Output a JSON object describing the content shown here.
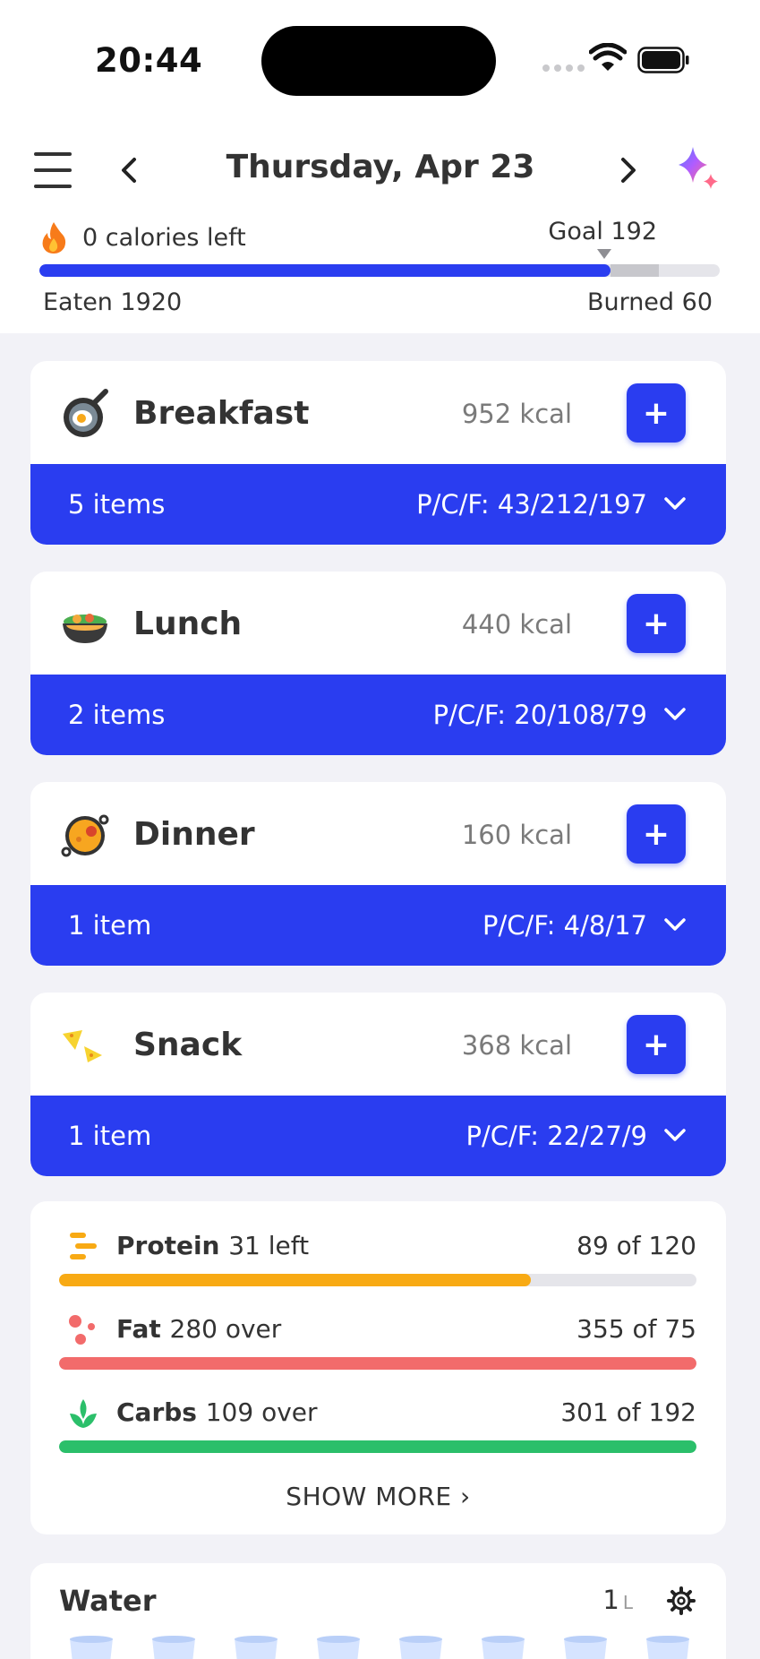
{
  "status_bar": {
    "time": "20:44"
  },
  "header": {
    "date": "Thursday, Apr 23"
  },
  "calories": {
    "left_label": "0 calories left",
    "goal_label": "Goal 192",
    "eaten_label": "Eaten 1920",
    "burned_label": "Burned 60",
    "progress_fraction": 0.84,
    "burned_fraction": 0.07
  },
  "meals": [
    {
      "name": "Breakfast",
      "kcal": "952 kcal",
      "items": "5 items",
      "pcf": "P/C/F: 43/212/197",
      "icon": "frying-pan-icon"
    },
    {
      "name": "Lunch",
      "kcal": "440 kcal",
      "items": "2 items",
      "pcf": "P/C/F: 20/108/79",
      "icon": "salad-bowl-icon"
    },
    {
      "name": "Dinner",
      "kcal": "160 kcal",
      "items": "1 item",
      "pcf": "P/C/F: 4/8/17",
      "icon": "paella-pan-icon"
    },
    {
      "name": "Snack",
      "kcal": "368 kcal",
      "items": "1 item",
      "pcf": "P/C/F: 22/27/9",
      "icon": "nachos-icon"
    }
  ],
  "add_label": "+",
  "macros": {
    "protein": {
      "name": "Protein",
      "status": "31 left",
      "value": "89 of 120",
      "fraction": 0.74,
      "color": "#f8aa14"
    },
    "fat": {
      "name": "Fat",
      "status": "280 over",
      "value": "355 of 75",
      "fraction": 1.0,
      "color": "#f26b6b"
    },
    "carbs": {
      "name": "Carbs",
      "status": "109 over",
      "value": "301 of 192",
      "fraction": 1.0,
      "color": "#2bbf6a"
    },
    "show_more": "SHOW MORE ›"
  },
  "water": {
    "title": "Water",
    "amount": "1",
    "unit": "L"
  },
  "colors": {
    "accent": "#2a3df0",
    "background": "#f2f2f7"
  }
}
